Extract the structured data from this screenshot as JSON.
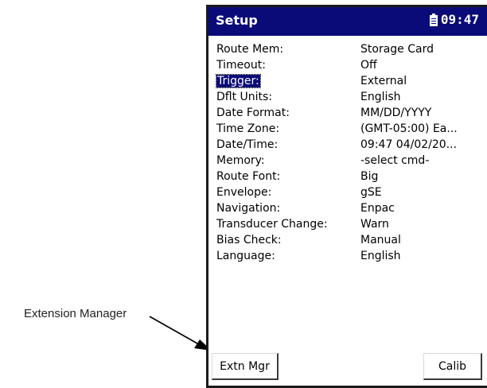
{
  "callout": {
    "label": "Extension Manager"
  },
  "window": {
    "title": "Setup",
    "status_icon": "battery-icon",
    "clock": "09:47"
  },
  "settings": [
    {
      "label": "Route Mem:",
      "value": "Storage Card"
    },
    {
      "label": "Timeout:",
      "value": "Off"
    },
    {
      "label": "Trigger:",
      "value": "External",
      "selected": true
    },
    {
      "label": "Dflt Units:",
      "value": "English"
    },
    {
      "label": "Date Format:",
      "value": "MM/DD/YYYY"
    },
    {
      "label": "Time Zone:",
      "value": "(GMT-05:00) Ea..."
    },
    {
      "label": "Date/Time:",
      "value": "09:47 04/02/20..."
    },
    {
      "label": "Memory:",
      "value": "-select cmd-"
    },
    {
      "label": "Route Font:",
      "value": "Big"
    },
    {
      "label": "Envelope:",
      "value": "gSE"
    },
    {
      "label": "Navigation:",
      "value": "Enpac"
    },
    {
      "label": "Transducer Change:",
      "value": "Warn"
    },
    {
      "label": "Bias Check:",
      "value": "Manual"
    },
    {
      "label": "Language:",
      "value": "English"
    }
  ],
  "softkeys": {
    "left_label": "Extn Mgr",
    "right_label": "Calib"
  },
  "colors": {
    "titlebar": "#0a0a78",
    "selection": "#0a0a78"
  }
}
